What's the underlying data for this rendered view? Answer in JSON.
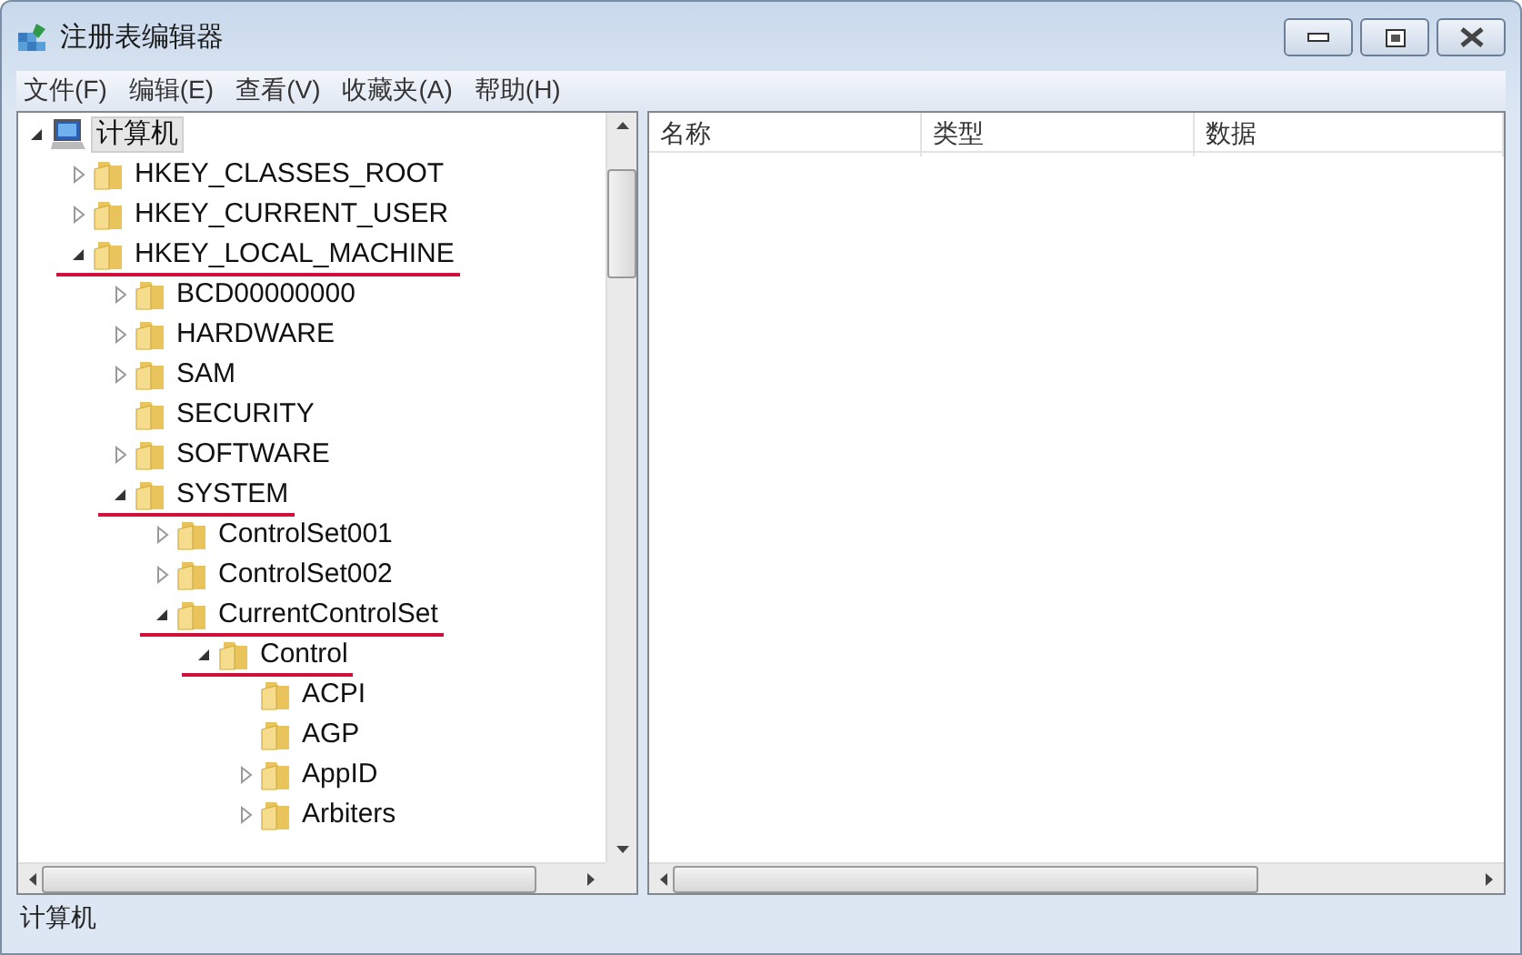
{
  "window": {
    "title": "注册表编辑器"
  },
  "menu": [
    "文件(F)",
    "编辑(E)",
    "查看(V)",
    "收藏夹(A)",
    "帮助(H)"
  ],
  "tree": [
    {
      "label": "计算机",
      "kind": "computer",
      "expandable": true,
      "expanded": true,
      "selected": true,
      "marked": false,
      "children": [
        {
          "label": "HKEY_CLASSES_ROOT",
          "kind": "folder",
          "expandable": true,
          "expanded": false,
          "selected": false,
          "marked": false
        },
        {
          "label": "HKEY_CURRENT_USER",
          "kind": "folder",
          "expandable": true,
          "expanded": false,
          "selected": false,
          "marked": false
        },
        {
          "label": "HKEY_LOCAL_MACHINE",
          "kind": "folder",
          "expandable": true,
          "expanded": true,
          "selected": false,
          "marked": true,
          "children": [
            {
              "label": "BCD00000000",
              "kind": "folder",
              "expandable": true,
              "expanded": false,
              "selected": false,
              "marked": false
            },
            {
              "label": "HARDWARE",
              "kind": "folder",
              "expandable": true,
              "expanded": false,
              "selected": false,
              "marked": false
            },
            {
              "label": "SAM",
              "kind": "folder",
              "expandable": true,
              "expanded": false,
              "selected": false,
              "marked": false
            },
            {
              "label": "SECURITY",
              "kind": "folder",
              "expandable": false,
              "selected": false,
              "marked": false
            },
            {
              "label": "SOFTWARE",
              "kind": "folder",
              "expandable": true,
              "expanded": false,
              "selected": false,
              "marked": false
            },
            {
              "label": "SYSTEM",
              "kind": "folder",
              "expandable": true,
              "expanded": true,
              "selected": false,
              "marked": true,
              "children": [
                {
                  "label": "ControlSet001",
                  "kind": "folder",
                  "expandable": true,
                  "expanded": false,
                  "selected": false,
                  "marked": false
                },
                {
                  "label": "ControlSet002",
                  "kind": "folder",
                  "expandable": true,
                  "expanded": false,
                  "selected": false,
                  "marked": false
                },
                {
                  "label": "CurrentControlSet",
                  "kind": "folder",
                  "expandable": true,
                  "expanded": true,
                  "selected": false,
                  "marked": true,
                  "children": [
                    {
                      "label": "Control",
                      "kind": "folder",
                      "expandable": true,
                      "expanded": true,
                      "selected": false,
                      "marked": true,
                      "children": [
                        {
                          "label": "ACPI",
                          "kind": "folder",
                          "expandable": false,
                          "selected": false,
                          "marked": false
                        },
                        {
                          "label": "AGP",
                          "kind": "folder",
                          "expandable": false,
                          "selected": false,
                          "marked": false
                        },
                        {
                          "label": "AppID",
                          "kind": "folder",
                          "expandable": true,
                          "expanded": false,
                          "selected": false,
                          "marked": false
                        },
                        {
                          "label": "Arbiters",
                          "kind": "folder",
                          "expandable": true,
                          "expanded": false,
                          "selected": false,
                          "marked": false
                        }
                      ]
                    }
                  ]
                }
              ]
            }
          ]
        }
      ]
    }
  ],
  "columns": [
    "名称",
    "类型",
    "数据"
  ],
  "status_bar": "计算机"
}
